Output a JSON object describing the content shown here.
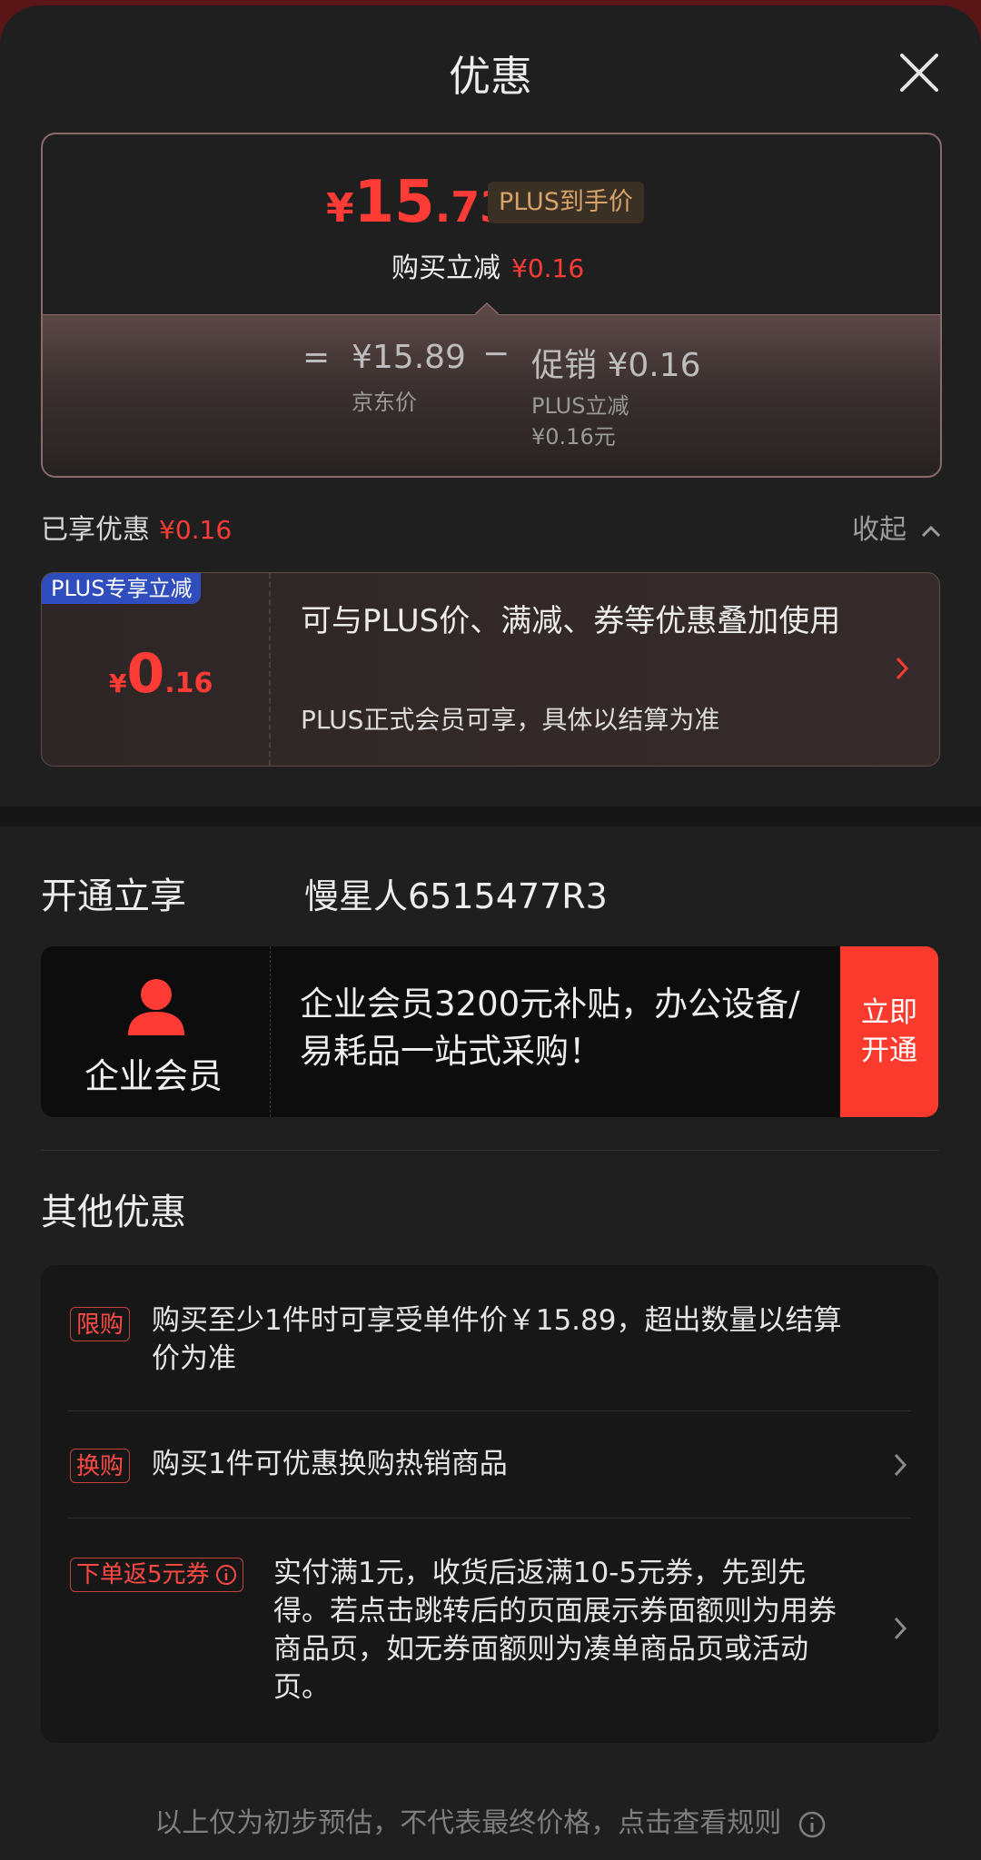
{
  "header": {
    "title": "优惠"
  },
  "price_card": {
    "yen": "¥",
    "price_int": "15",
    "price_dec": ".73",
    "plus_badge": "PLUS到手价",
    "reduce_label": "购买立减",
    "reduce_amount": "¥0.16",
    "eq": "=",
    "jd_price": "¥15.89",
    "jd_label": "京东价",
    "minus": "−",
    "promo": "促销 ¥0.16",
    "promo_sub1": "PLUS立减",
    "promo_sub2": "¥0.16元"
  },
  "enjoyed": {
    "label": "已享优惠",
    "amount": "¥0.16",
    "collapse": "收起"
  },
  "plus_card": {
    "tag": "PLUS专享立减",
    "yen": "¥",
    "int": "0",
    "dec": ".16",
    "desc": "可与PLUS价、满减、券等优惠叠加使用",
    "sub": "PLUS正式会员可享，具体以结算为准"
  },
  "membership": {
    "label": "开通立享",
    "user": "慢星人6515477R3",
    "vip_name": "企业会员",
    "vip_desc": "企业会员3200元补贴，办公设备/易耗品一站式采购！",
    "button": "立即开通"
  },
  "other": {
    "title": "其他优惠",
    "items": [
      {
        "tag": "限购",
        "text": "购买至少1件时可享受单件价￥15.89，超出数量以结算价为准"
      },
      {
        "tag": "换购",
        "text": "购买1件可优惠换购热销商品"
      },
      {
        "tag": "下单返5元券",
        "text": "实付满1元，收货后返满10-5元券，先到先得。若点击跳转后的页面展示券面额则为用券商品页，如无券面额则为凑单商品页或活动页。"
      }
    ]
  },
  "footer": {
    "text": "以上仅为初步预估，不代表最终价格，点击查看规则"
  },
  "colors": {
    "accent_red": "#ff3b36",
    "plus_blue": "#2f4dbd",
    "vip_button": "#fa3a2c"
  }
}
